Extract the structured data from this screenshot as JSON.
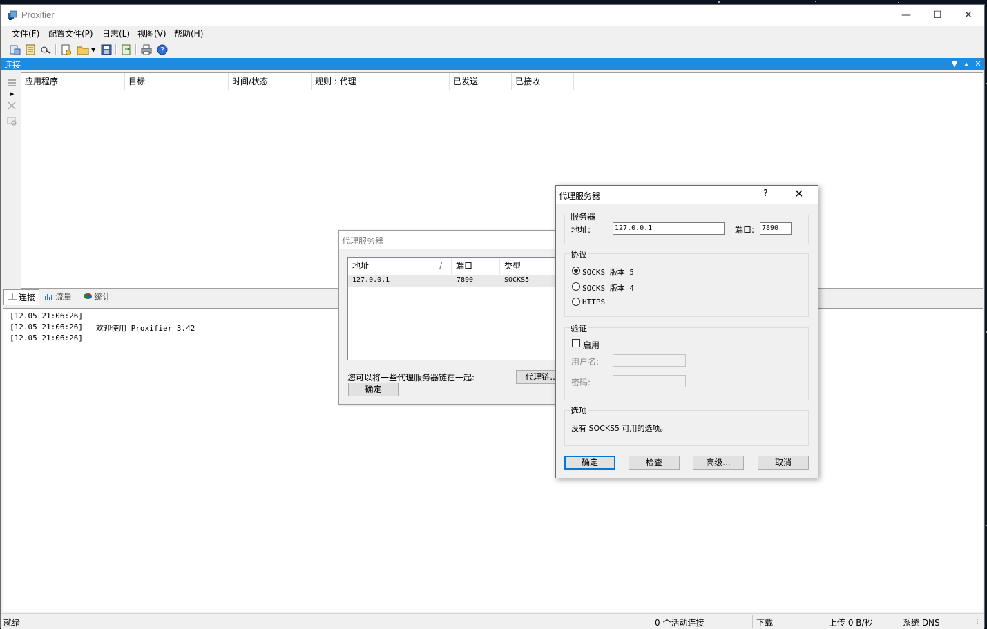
{
  "window": {
    "title": "Proxifier"
  },
  "menu": [
    "文件(F)",
    "配置文件(P)",
    "日志(L)",
    "视图(V)",
    "帮助(H)"
  ],
  "toolbar_icons": [
    "connections-icon",
    "proxy-servers-icon",
    "proxification-rules-icon",
    "new-profile-icon",
    "open-profile-icon",
    "save-profile-icon",
    "export-icon",
    "print-icon",
    "help-icon"
  ],
  "connections_panel": {
    "title": "连接",
    "columns": [
      "应用程序",
      "目标",
      "时间/状态",
      "规则 : 代理",
      "已发送",
      "已接收"
    ]
  },
  "tabs": [
    "连接",
    "流量",
    "统计"
  ],
  "log": [
    {
      "time": "[12.05 21:06:26]",
      "msg": ""
    },
    {
      "time": "[12.05 21:06:26]",
      "msg": "欢迎使用 Proxifier 3.42"
    },
    {
      "time": "[12.05 21:06:26]",
      "msg": ""
    }
  ],
  "statusbar": {
    "ready": "就绪",
    "active": "0 个活动连接",
    "download": "下载",
    "upload": "上传 0 B/秒",
    "dns": "系统 DNS"
  },
  "proxy_list_dialog": {
    "title": "代理服务器",
    "columns": [
      "地址",
      "端口",
      "类型"
    ],
    "sort_mark": "∕",
    "rows": [
      {
        "address": "127.0.0.1",
        "port": "7890",
        "type": "SOCKS5"
      }
    ],
    "chain_text": "您可以将一些代理服务器链在一起:",
    "chain_button": "代理链...",
    "ok": "确定"
  },
  "proxy_dialog": {
    "title": "代理服务器",
    "help": "?",
    "server_group": "服务器",
    "address_label": "地址:",
    "address_value": "127.0.0.1",
    "port_label": "端口:",
    "port_value": "7890",
    "protocol_group": "协议",
    "protocols": [
      "SOCKS 版本 5",
      "SOCKS 版本 4",
      "HTTPS"
    ],
    "selected_protocol": "SOCKS 版本 5",
    "auth_group": "验证",
    "enable_label": "启用",
    "enabled": false,
    "username_label": "用户名:",
    "password_label": "密码:",
    "options_group": "选项",
    "options_text": "没有 SOCKS5 可用的选项。",
    "buttons": {
      "ok": "确定",
      "check": "检查",
      "advanced": "高级...",
      "cancel": "取消"
    }
  }
}
